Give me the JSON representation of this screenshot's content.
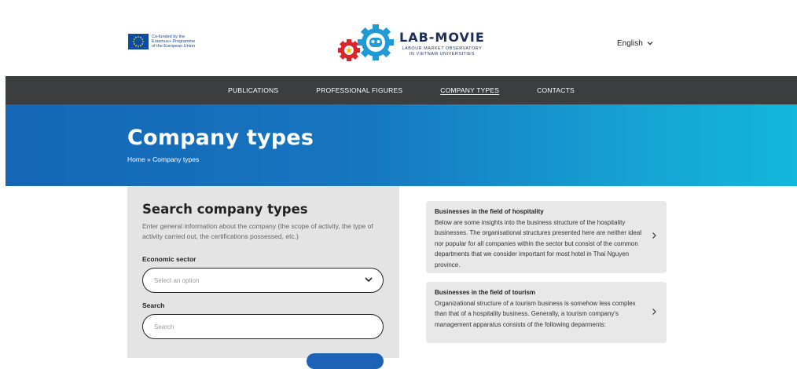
{
  "header": {
    "eu_text": "Co-funded by the\nErasmus+ Programme\nof the European Union",
    "logo_title": "LAB-MOVIE",
    "logo_subtitle": "LABOUR MARKET OBSERVATORY\nIN VIETNAM UNIVERSITIES",
    "language": "English"
  },
  "nav": {
    "items": [
      {
        "label": "PUBLICATIONS"
      },
      {
        "label": "PROFESSIONAL FIGURES"
      },
      {
        "label": "COMPANY TYPES"
      },
      {
        "label": "CONTACTS"
      }
    ]
  },
  "banner": {
    "title": "Company types",
    "breadcrumb_home": "Home",
    "breadcrumb_sep": " » ",
    "breadcrumb_current": "Company types"
  },
  "search": {
    "title": "Search company types",
    "intro": "Enter general information about the company (the scope of activity, the type of activity carried out, the certifications possessed, etc.)",
    "sector_label": "Economic sector",
    "sector_placeholder": "Select an option",
    "search_label": "Search",
    "search_placeholder": "Search"
  },
  "cards": [
    {
      "title": "Businesses in the field of hospitality",
      "body": "Below are some insights into the business structure of the hospitality businesses. The organisational structures presented here are neither ideal nor popular for all companies within the sector but consist of the common departments that we consider important for most hotel in Thai Nguyen province."
    },
    {
      "title": "Businesses in the field of tourism",
      "body": "Organizational structure of a tourism business is somehow less complex than that of a hospitality business. Generally, a tourism company's management apparatus consists of the following deparments:"
    }
  ],
  "colors": {
    "nav_bg": "#3c3d3e",
    "banner_start": "#1566b5",
    "banner_end": "#12b7dc",
    "panel_bg": "#e4e4e4",
    "card_bg": "#e8e8e8",
    "button": "#1d63b5"
  }
}
